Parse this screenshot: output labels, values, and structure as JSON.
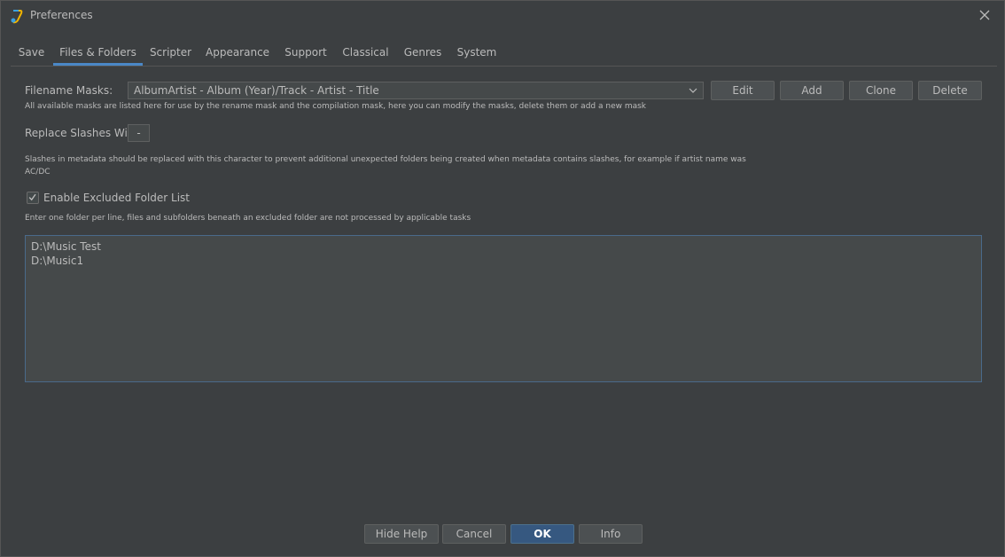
{
  "window": {
    "title": "Preferences",
    "accent": "#4a88c7"
  },
  "tabs": [
    {
      "label": "Save",
      "active": false
    },
    {
      "label": "Files & Folders",
      "active": true
    },
    {
      "label": "Scripter",
      "active": false
    },
    {
      "label": "Appearance",
      "active": false
    },
    {
      "label": "Support",
      "active": false
    },
    {
      "label": "Classical",
      "active": false
    },
    {
      "label": "Genres",
      "active": false
    },
    {
      "label": "System",
      "active": false
    }
  ],
  "filename_masks": {
    "label": "Filename Masks:",
    "selected": "AlbumArtist - Album (Year)/Track - Artist - Title",
    "help": "All available masks are listed here for use by the rename mask and the compilation mask, here you can modify the masks, delete them or add a new mask",
    "buttons": {
      "edit": "Edit",
      "add": "Add",
      "clone": "Clone",
      "delete": "Delete"
    }
  },
  "replace_slashes": {
    "label": "Replace Slashes With",
    "value": "-",
    "help_line1": "Slashes in metadata should be replaced with this character to prevent additional unexpected folders being created when metadata contains slashes, for example if artist name was",
    "help_line2": "AC/DC"
  },
  "excluded_folders": {
    "checkbox_label": "Enable Excluded Folder List",
    "checked": true,
    "help": "Enter one folder per line, files and subfolders beneath an excluded folder are not processed by applicable tasks",
    "lines": [
      "D:\\Music Test",
      "D:\\Music1"
    ]
  },
  "footer": {
    "hide_help": "Hide Help",
    "cancel": "Cancel",
    "ok": "OK",
    "info": "Info"
  }
}
